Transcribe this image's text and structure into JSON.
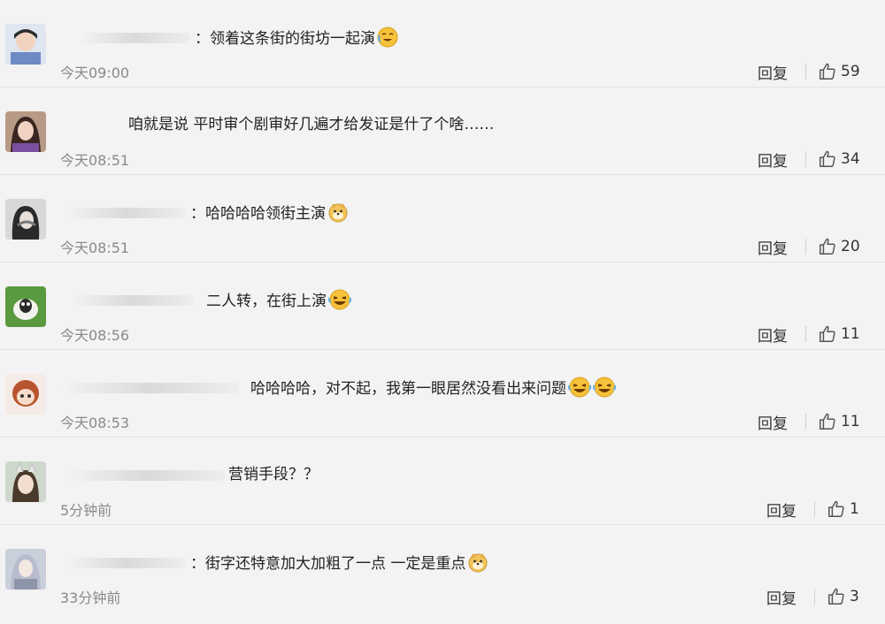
{
  "comments": [
    {
      "prefix": "：",
      "text": "领着这条街的街坊一起演",
      "emoji": "cry-laugh",
      "time": "今天09:00",
      "reply": "回复",
      "likes": "59",
      "avatar_color": "#6d8ac4"
    },
    {
      "prefix": "",
      "text": "咱就是说 平时审个剧审好几遍才给发证是什了个啥……",
      "emoji": "",
      "time": "今天08:51",
      "reply": "回复",
      "likes": "34",
      "avatar_color": "#6a4a3a"
    },
    {
      "prefix": "：",
      "text": "哈哈哈哈领街主演",
      "emoji": "doge",
      "time": "今天08:51",
      "reply": "回复",
      "likes": "20",
      "avatar_color": "#9a9a9a"
    },
    {
      "prefix": "",
      "text": "二人转，在街上演",
      "emoji": "laugh-cry",
      "time": "今天08:56",
      "reply": "回复",
      "likes": "11",
      "avatar_color": "#4f8a3a"
    },
    {
      "prefix": "",
      "text": "哈哈哈哈，对不起，我第一眼居然没看出来问题",
      "emoji": "laugh-cry-2",
      "time": "今天08:53",
      "reply": "回复",
      "likes": "11",
      "avatar_color": "#c7744a"
    },
    {
      "prefix": "",
      "text": "营销手段？？",
      "emoji": "",
      "time": "5分钟前",
      "reply": "回复",
      "likes": "1",
      "avatar_color": "#5a6a5a"
    },
    {
      "prefix": "：",
      "text": "街字还特意加大加粗了一点 一定是重点",
      "emoji": "doge",
      "time": "33分钟前",
      "reply": "回复",
      "likes": "3",
      "avatar_color": "#8f95a8"
    }
  ],
  "colors": {
    "background": "#f3f3f3",
    "timestamp": "#8a8a8a",
    "emoji_face": "#f6c23a"
  }
}
